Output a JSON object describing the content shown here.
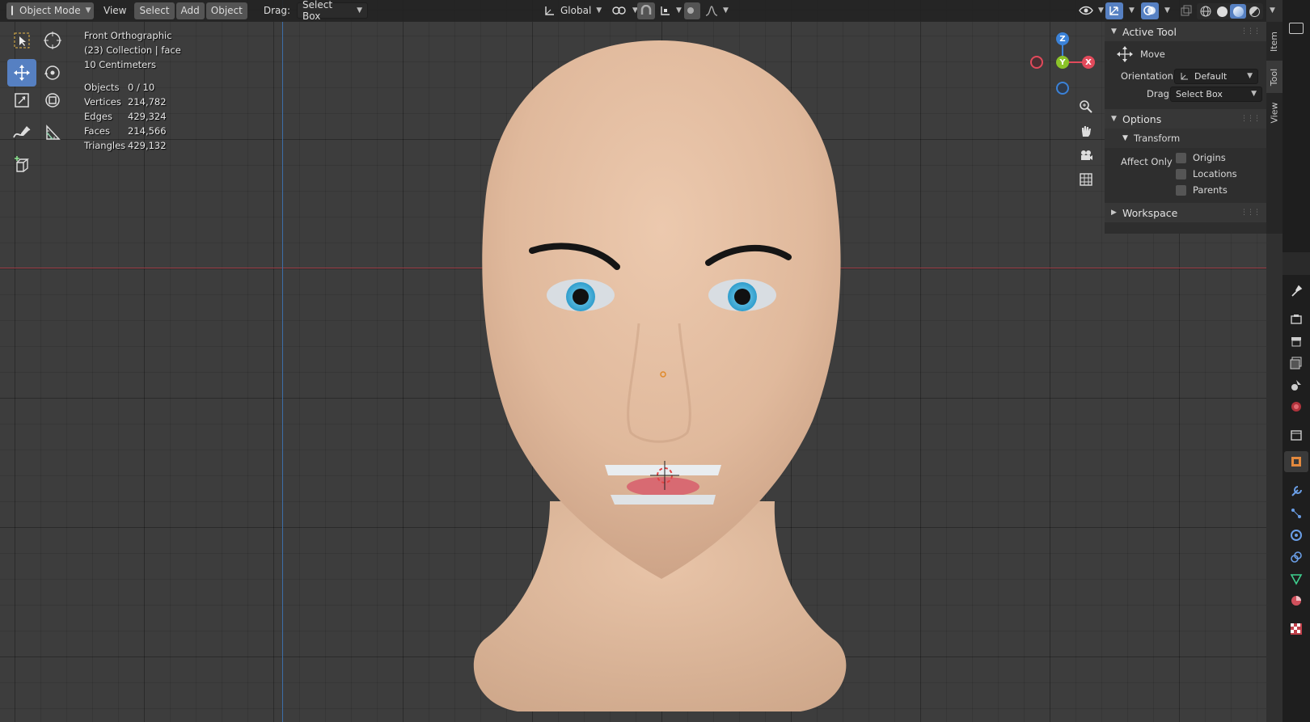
{
  "header": {
    "mode": "Object Mode",
    "menu_view": "View",
    "menu_select": "Select",
    "menu_add": "Add",
    "menu_object": "Object",
    "drag_label": "Drag:",
    "drag_value": "Select Box",
    "transform_orientation": "Global"
  },
  "overlay": {
    "view_name": "Front Orthographic",
    "collection": "(23) Collection | face",
    "scale": "10 Centimeters",
    "stats": [
      {
        "label": "Objects",
        "value": "0 / 10"
      },
      {
        "label": "Vertices",
        "value": "214,782"
      },
      {
        "label": "Edges",
        "value": "429,324"
      },
      {
        "label": "Faces",
        "value": "214,566"
      },
      {
        "label": "Triangles",
        "value": "429,132"
      }
    ]
  },
  "gizmo": {
    "z": "Z",
    "y": "Y",
    "x": "X"
  },
  "npanel": {
    "active_tool_title": "Active Tool",
    "tool_name": "Move",
    "orientation_label": "Orientation",
    "orientation_value": "Default",
    "drag_label": "Drag:",
    "drag_value": "Select Box",
    "options_title": "Options",
    "transform_title": "Transform",
    "affect_only_label": "Affect Only",
    "affect_options": [
      "Origins",
      "Locations",
      "Parents"
    ],
    "workspace_title": "Workspace"
  },
  "side_tabs": [
    "Item",
    "Tool",
    "View"
  ],
  "colors": {
    "accent": "#5680c2",
    "axis_x": "#a04049",
    "axis_z": "#3d6ea8",
    "gizmo_x": "#e24a5b",
    "gizmo_y": "#8bc329",
    "gizmo_z": "#3b82d8",
    "skin": "#e2bda1"
  }
}
